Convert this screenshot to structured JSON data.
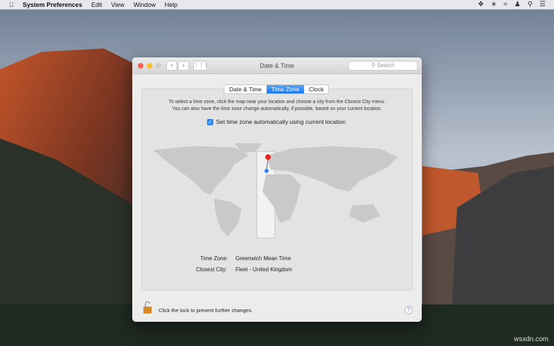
{
  "menubar": {
    "app": "System Preferences",
    "items": [
      "Edit",
      "View",
      "Window",
      "Help"
    ]
  },
  "window": {
    "title": "Date & Time",
    "search_placeholder": "Search",
    "tabs": [
      "Date & Time",
      "Time Zone",
      "Clock"
    ],
    "description_line1": "To select a time zone, click the map near your location and choose a city from the Closest City menu.",
    "description_line2": "You can also have the time zone change automatically, if possible, based on your current location.",
    "auto_checkbox": "Set time zone automatically using current location",
    "auto_checked": true,
    "time_zone_label": "Time Zone:",
    "time_zone_value": "Greenwich Mean Time",
    "closest_city_label": "Closest City:",
    "closest_city_value": "Fleet - United Kingdom",
    "lock_text": "Click the lock to prevent further changes.",
    "help": "?"
  },
  "watermark": "wsxdn.com"
}
